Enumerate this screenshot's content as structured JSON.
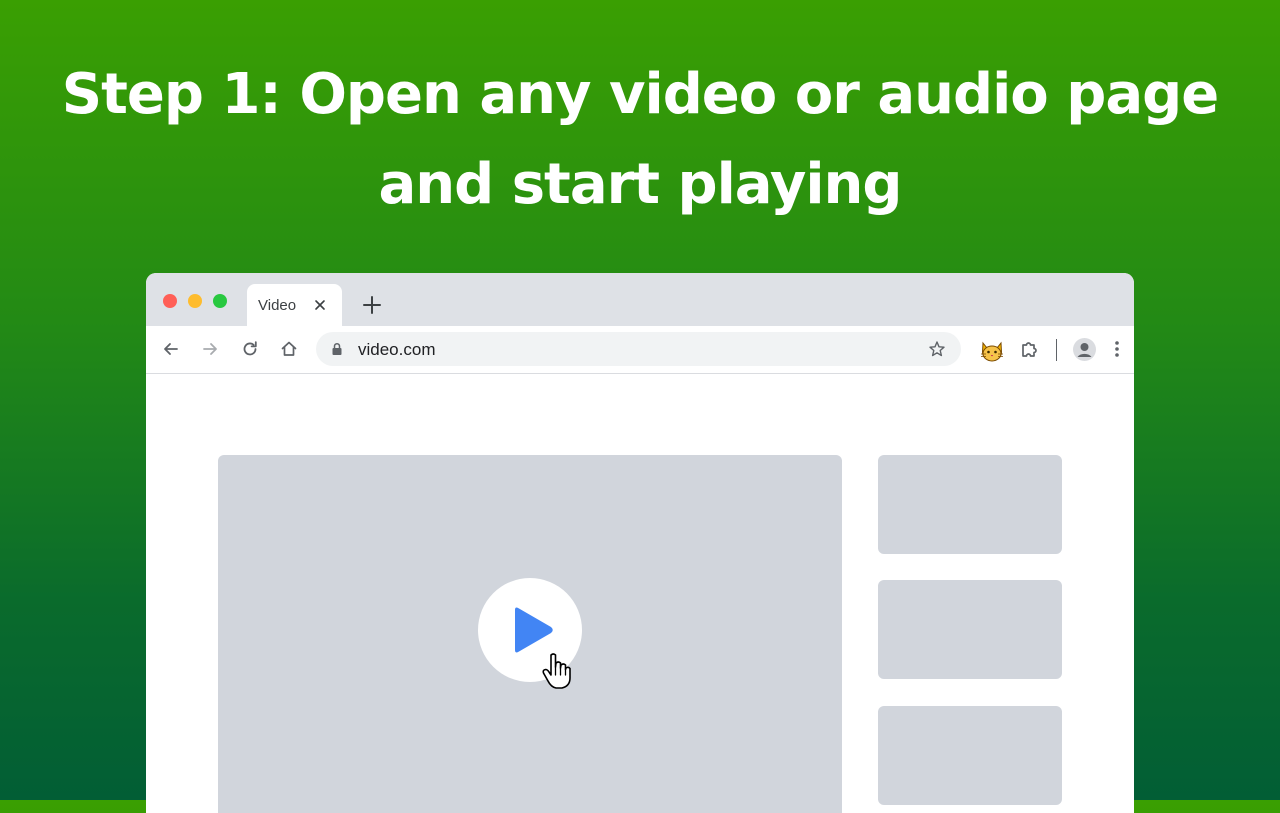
{
  "headline": {
    "line1": "Step 1: Open any video or audio page",
    "line2": "and start playing"
  },
  "browser": {
    "tab": {
      "title": "Video",
      "close_icon": "close-icon"
    },
    "new_tab_icon": "plus-icon",
    "toolbar": {
      "back_icon": "arrow-left-icon",
      "forward_icon": "arrow-right-icon",
      "reload_icon": "reload-icon",
      "home_icon": "home-icon",
      "address": {
        "url": "video.com",
        "lock_icon": "lock-icon",
        "bookmark_icon": "star-icon"
      },
      "extensions": [
        "cat-extension-icon",
        "puzzle-icon"
      ],
      "profile_icon": "avatar-icon",
      "menu_icon": "more-vert-icon"
    }
  },
  "content": {
    "video_player": {
      "play_icon": "play-icon",
      "cursor_icon": "hand-pointer-icon"
    },
    "sidebar_cards": 3
  },
  "colors": {
    "background_top": "#3a9f02",
    "background_bottom": "#025e35",
    "placeholder": "#d1d5dc",
    "play_accent": "#4285f4",
    "tabbar": "#dee1e6"
  }
}
